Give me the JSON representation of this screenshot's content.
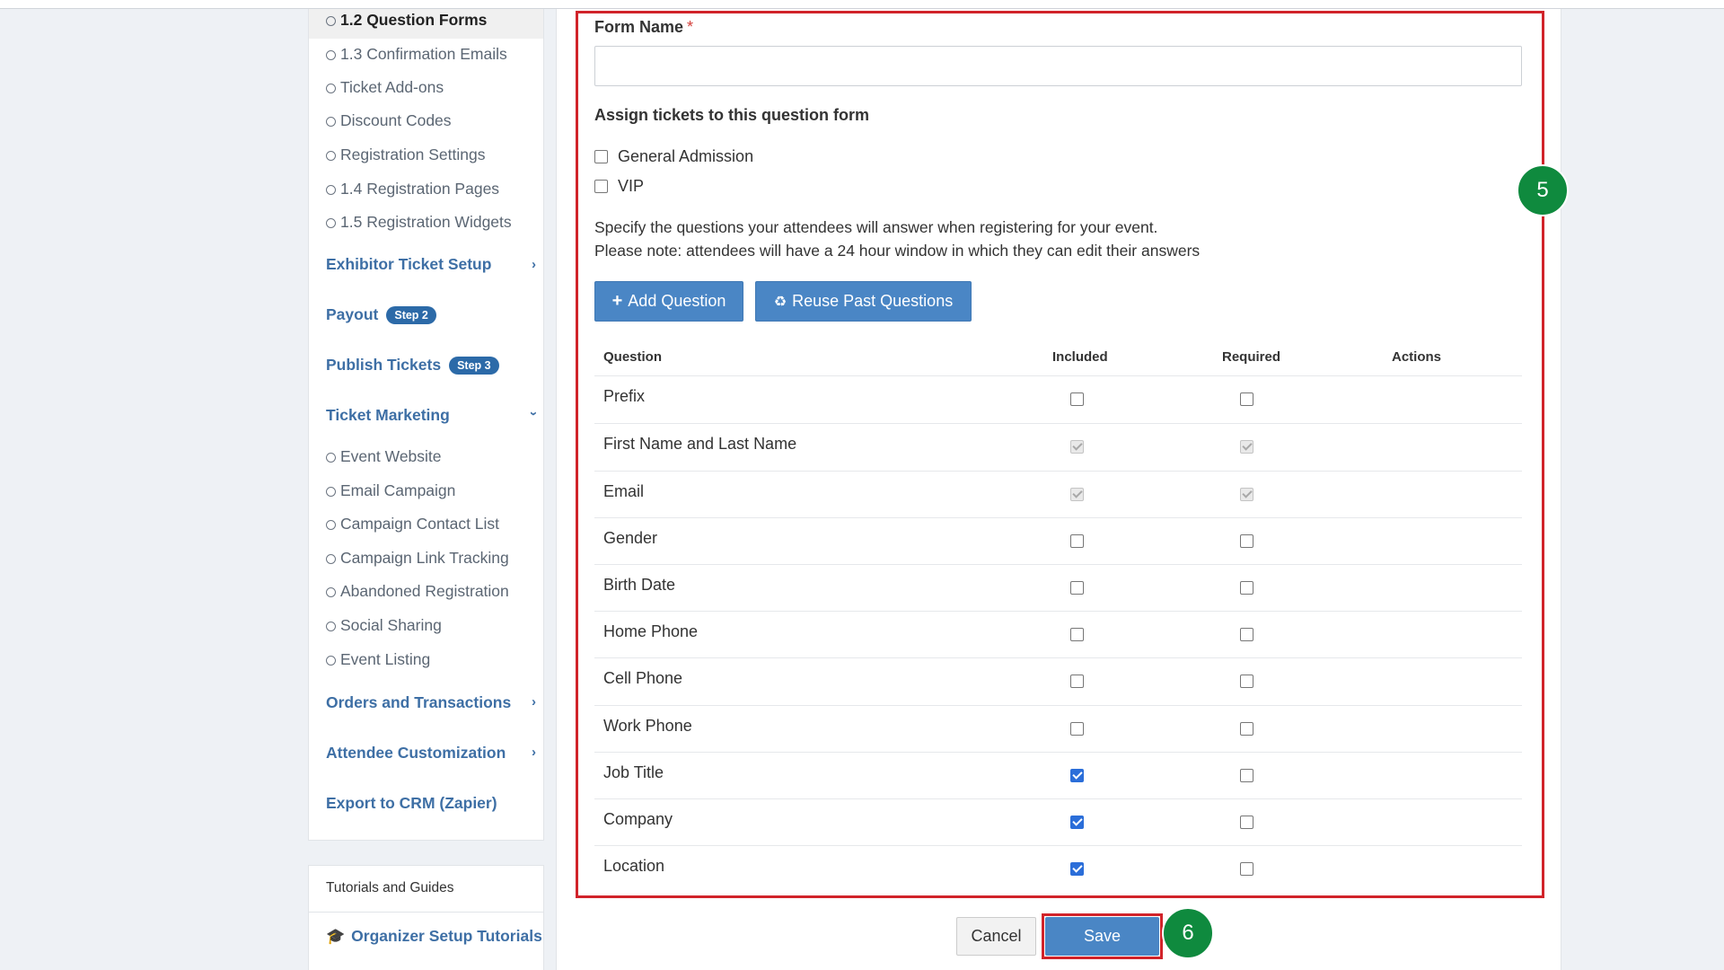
{
  "sidebar": {
    "sub_items_top": [
      {
        "label": "1.2 Question Forms",
        "active": true
      },
      {
        "label": "1.3 Confirmation Emails"
      },
      {
        "label": "Ticket Add-ons"
      },
      {
        "label": "Discount Codes"
      },
      {
        "label": "Registration Settings"
      },
      {
        "label": "1.4 Registration Pages"
      },
      {
        "label": "1.5 Registration Widgets"
      }
    ],
    "exhibitor": "Exhibitor Ticket Setup",
    "payout": "Payout",
    "payout_badge": "Step 2",
    "publish": "Publish Tickets",
    "publish_badge": "Step 3",
    "marketing": "Ticket Marketing",
    "marketing_items": [
      "Event Website",
      "Email Campaign",
      "Campaign Contact List",
      "Campaign Link Tracking",
      "Abandoned Registration",
      "Social Sharing",
      "Event Listing"
    ],
    "orders": "Orders and Transactions",
    "attendee": "Attendee Customization",
    "export": "Export to CRM (Zapier)"
  },
  "tutorials": {
    "heading": "Tutorials and Guides",
    "link": "Organizer Setup Tutorials"
  },
  "form": {
    "name_label": "Form Name",
    "required_mark": "*",
    "name_value": "",
    "assign_label": "Assign tickets to this question form",
    "tickets": [
      "General Admission",
      "VIP"
    ],
    "desc_line1": "Specify the questions your attendees will answer when registering for your event.",
    "desc_line2": "Please note: attendees will have a 24 hour window in which they can edit their answers",
    "add_question": "Add Question",
    "reuse": "Reuse Past Questions"
  },
  "table": {
    "headers": {
      "question": "Question",
      "included": "Included",
      "required": "Required",
      "actions": "Actions"
    },
    "rows": [
      {
        "q": "Prefix",
        "included": "unchecked",
        "required": "unchecked"
      },
      {
        "q": "First Name and Last Name",
        "included": "disabled",
        "required": "disabled"
      },
      {
        "q": "Email",
        "included": "disabled",
        "required": "disabled"
      },
      {
        "q": "Gender",
        "included": "unchecked",
        "required": "unchecked"
      },
      {
        "q": "Birth Date",
        "included": "unchecked",
        "required": "unchecked"
      },
      {
        "q": "Home Phone",
        "included": "unchecked",
        "required": "unchecked"
      },
      {
        "q": "Cell Phone",
        "included": "unchecked",
        "required": "unchecked"
      },
      {
        "q": "Work Phone",
        "included": "unchecked",
        "required": "unchecked"
      },
      {
        "q": "Job Title",
        "included": "checked",
        "required": "unchecked"
      },
      {
        "q": "Company",
        "included": "checked",
        "required": "unchecked"
      },
      {
        "q": "Location",
        "included": "checked",
        "required": "unchecked"
      }
    ]
  },
  "footer": {
    "cancel": "Cancel",
    "save": "Save"
  },
  "steps": {
    "five": "5",
    "six": "6"
  },
  "colors": {
    "accent": "#4a86c5",
    "link": "#3e6fa5",
    "highlight": "#d1232a",
    "step": "#0f8a3e"
  }
}
